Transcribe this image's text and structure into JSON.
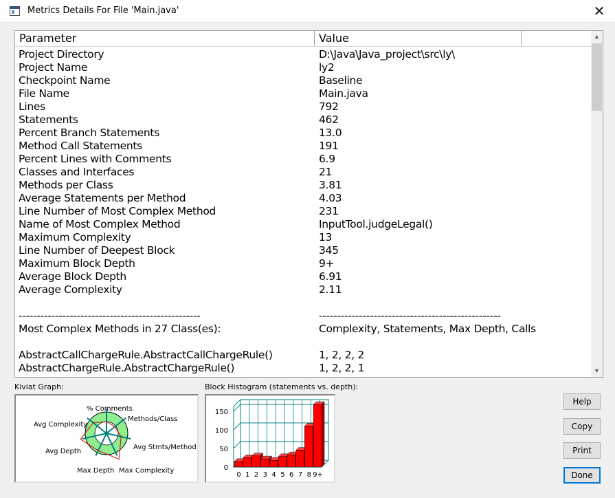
{
  "window": {
    "title": "Metrics Details For File 'Main.java'",
    "close_glyph": "✕"
  },
  "table": {
    "columns": [
      "Parameter",
      "Value",
      ""
    ],
    "rows": [
      [
        "Project Directory",
        "D:\\Java\\Java_project\\src\\ly\\"
      ],
      [
        "Project Name",
        "ly2"
      ],
      [
        "Checkpoint Name",
        "Baseline"
      ],
      [
        "File Name",
        "Main.java"
      ],
      [
        "Lines",
        "792"
      ],
      [
        "Statements",
        "462"
      ],
      [
        "Percent Branch Statements",
        "13.0"
      ],
      [
        "Method Call Statements",
        "191"
      ],
      [
        "Percent Lines with Comments",
        "6.9"
      ],
      [
        "Classes and Interfaces",
        "21"
      ],
      [
        "Methods per Class",
        "3.81"
      ],
      [
        "Average Statements per Method",
        "4.03"
      ],
      [
        "Line Number of Most Complex Method",
        "231"
      ],
      [
        "Name of Most Complex Method",
        "InputTool.judgeLegal()"
      ],
      [
        "Maximum Complexity",
        "13"
      ],
      [
        "Line Number of Deepest Block",
        "345"
      ],
      [
        "Maximum Block Depth",
        "9+"
      ],
      [
        "Average Block Depth",
        "6.91"
      ],
      [
        "Average Complexity",
        "2.11"
      ],
      [
        "",
        ""
      ],
      [
        "--------------------------------------------------",
        "--------------------------------------------------"
      ],
      [
        "Most Complex Methods in 27 Class(es):",
        "Complexity, Statements, Max Depth, Calls"
      ],
      [
        "",
        ""
      ],
      [
        "AbstractCallChargeRule.AbstractCallChargeRule()",
        "1, 2, 2, 2"
      ],
      [
        "AbstractChargeRule.AbstractChargeRule()",
        "1, 2, 2, 1"
      ]
    ]
  },
  "kiviat": {
    "label": "Kiviat Graph:",
    "axes": [
      "% Comments",
      "Methods/Class",
      "Avg Stmts/Method",
      "Max Complexity",
      "Max Depth",
      "Avg Depth",
      "Avg Complexity"
    ]
  },
  "histogram": {
    "label": "Block Histogram (statements vs. depth):",
    "y_ticks": [
      "150",
      "100",
      "50",
      "0"
    ],
    "x_labels": [
      "0",
      "1",
      "2",
      "3",
      "4",
      "5",
      "6",
      "7",
      "8",
      "9+"
    ]
  },
  "buttons": {
    "help": "Help",
    "copy": "Copy",
    "print": "Print",
    "done": "Done"
  },
  "colors": {
    "bar": "#ff0000",
    "kiviat_ring": "#90ee90",
    "grid": "#008080"
  },
  "chart_data": {
    "type": "bar",
    "categories": [
      "0",
      "1",
      "2",
      "3",
      "4",
      "5",
      "6",
      "7",
      "8",
      "9+"
    ],
    "values": [
      15,
      25,
      30,
      22,
      18,
      28,
      33,
      45,
      110,
      168
    ],
    "ylim": [
      0,
      170
    ],
    "grid": true,
    "legend": "none"
  }
}
